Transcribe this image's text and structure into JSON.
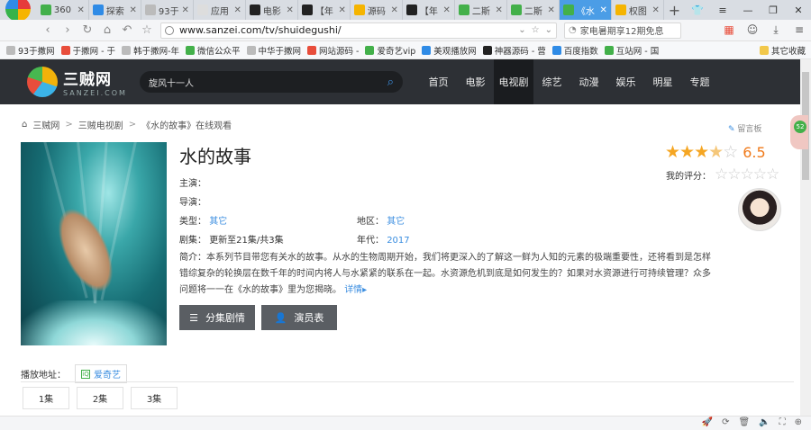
{
  "browser": {
    "tabs": [
      {
        "label": "360",
        "color": "#43b04a"
      },
      {
        "label": "探索",
        "color": "#2f8be6"
      },
      {
        "label": "93于",
        "color": "#bbbbbb"
      },
      {
        "label": "应用",
        "color": "#dddddd"
      },
      {
        "label": "电影",
        "color": "#222222"
      },
      {
        "label": "【年",
        "color": "#222222"
      },
      {
        "label": "源码",
        "color": "#f5b400"
      },
      {
        "label": "【年",
        "color": "#222222"
      },
      {
        "label": "二斯",
        "color": "#43b04a"
      },
      {
        "label": "二斯",
        "color": "#43b04a"
      },
      {
        "label": "《水",
        "color": "#43b04a",
        "active": true
      },
      {
        "label": "权图",
        "color": "#f5b400"
      }
    ],
    "new_tab": "+",
    "url": "www.sanzei.com/tv/shuidegushi/",
    "search_text": "家电暑期享12期免息",
    "bookmarks": [
      {
        "label": "93于撒网",
        "color": "#bbbbbb"
      },
      {
        "label": "于撒网 - 于",
        "color": "#e84d3b"
      },
      {
        "label": "韩于撒网-年",
        "color": "#bbbbbb"
      },
      {
        "label": "微信公众平",
        "color": "#43b04a"
      },
      {
        "label": "中华于撒网",
        "color": "#bbbbbb"
      },
      {
        "label": "网站源码 -",
        "color": "#e84d3b"
      },
      {
        "label": "爱奇艺vip",
        "color": "#43b04a"
      },
      {
        "label": "美观播放网",
        "color": "#2f8be6"
      },
      {
        "label": "神器源码 - 营",
        "color": "#222222"
      },
      {
        "label": "百度指数",
        "color": "#2f8be6"
      },
      {
        "label": "互站网 - 国",
        "color": "#43b04a"
      }
    ],
    "other_bookmarks": "其它收藏"
  },
  "site": {
    "brand": "三贼网",
    "brand_en": "SANZEI.COM",
    "search_value": "旋风十一人",
    "nav": [
      "首页",
      "电影",
      "电视剧",
      "综艺",
      "动漫",
      "娱乐",
      "明星",
      "专题"
    ],
    "nav_active": 2
  },
  "breadcrumb": [
    "三贼网",
    "三贼电视剧",
    "《水的故事》在线观看"
  ],
  "report": "留言板",
  "show": {
    "title": "水的故事",
    "lead_label": "主演：",
    "director_label": "导演：",
    "type_label": "类型：",
    "type_value": "其它",
    "region_label": "地区：",
    "region_value": "其它",
    "episodes_label": "剧集：",
    "episodes_value": "更新至21集/共3集",
    "year_label": "年代：",
    "year_value": "2017",
    "intro_label": "简介：",
    "intro": "本系列节目带您有关水的故事。从水的生物周期开始，我们将更深入的了解这一鲜为人知的元素的极端重要性，还将看到是怎样错综复杂的轮换层在数千年的时间内将人与水紧紧的联系在一起。水资源危机到底是如何发生的？如果对水资源进行可持续管理？众多问题将一一在《水的故事》里为您揭晓。",
    "more": "详情▸",
    "rating": 6.5,
    "stars_filled": 3,
    "my_rating_label": "我的评分："
  },
  "buttons": {
    "episodes": "分集剧情",
    "cast": "演员表"
  },
  "play": {
    "label": "播放地址：",
    "source": "爱奇艺"
  },
  "episodes": [
    "1集",
    "2集",
    "3集"
  ]
}
